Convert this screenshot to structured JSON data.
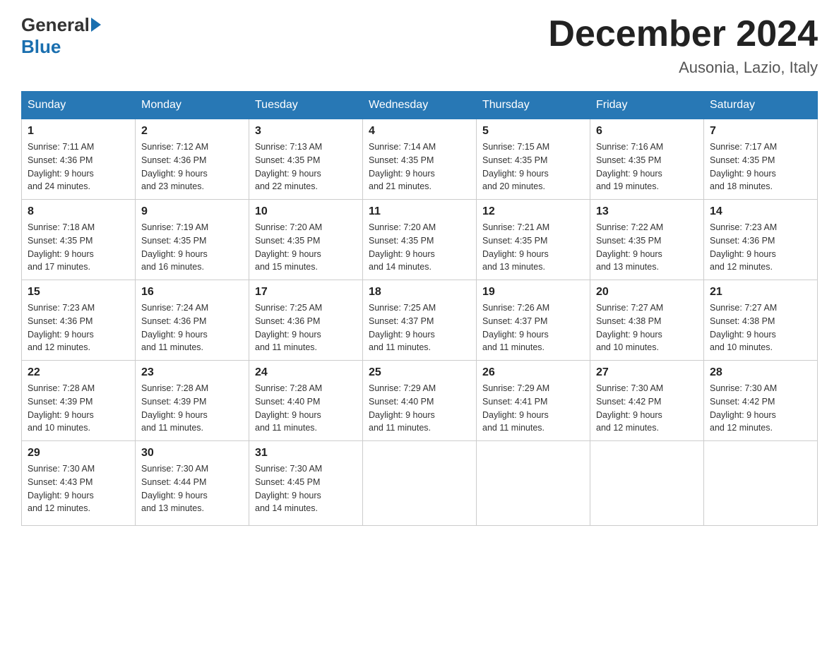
{
  "logo": {
    "general": "General",
    "blue": "Blue"
  },
  "title": "December 2024",
  "subtitle": "Ausonia, Lazio, Italy",
  "weekdays": [
    "Sunday",
    "Monday",
    "Tuesday",
    "Wednesday",
    "Thursday",
    "Friday",
    "Saturday"
  ],
  "weeks": [
    [
      {
        "day": "1",
        "sunrise": "7:11 AM",
        "sunset": "4:36 PM",
        "daylight": "9 hours and 24 minutes."
      },
      {
        "day": "2",
        "sunrise": "7:12 AM",
        "sunset": "4:36 PM",
        "daylight": "9 hours and 23 minutes."
      },
      {
        "day": "3",
        "sunrise": "7:13 AM",
        "sunset": "4:35 PM",
        "daylight": "9 hours and 22 minutes."
      },
      {
        "day": "4",
        "sunrise": "7:14 AM",
        "sunset": "4:35 PM",
        "daylight": "9 hours and 21 minutes."
      },
      {
        "day": "5",
        "sunrise": "7:15 AM",
        "sunset": "4:35 PM",
        "daylight": "9 hours and 20 minutes."
      },
      {
        "day": "6",
        "sunrise": "7:16 AM",
        "sunset": "4:35 PM",
        "daylight": "9 hours and 19 minutes."
      },
      {
        "day": "7",
        "sunrise": "7:17 AM",
        "sunset": "4:35 PM",
        "daylight": "9 hours and 18 minutes."
      }
    ],
    [
      {
        "day": "8",
        "sunrise": "7:18 AM",
        "sunset": "4:35 PM",
        "daylight": "9 hours and 17 minutes."
      },
      {
        "day": "9",
        "sunrise": "7:19 AM",
        "sunset": "4:35 PM",
        "daylight": "9 hours and 16 minutes."
      },
      {
        "day": "10",
        "sunrise": "7:20 AM",
        "sunset": "4:35 PM",
        "daylight": "9 hours and 15 minutes."
      },
      {
        "day": "11",
        "sunrise": "7:20 AM",
        "sunset": "4:35 PM",
        "daylight": "9 hours and 14 minutes."
      },
      {
        "day": "12",
        "sunrise": "7:21 AM",
        "sunset": "4:35 PM",
        "daylight": "9 hours and 13 minutes."
      },
      {
        "day": "13",
        "sunrise": "7:22 AM",
        "sunset": "4:35 PM",
        "daylight": "9 hours and 13 minutes."
      },
      {
        "day": "14",
        "sunrise": "7:23 AM",
        "sunset": "4:36 PM",
        "daylight": "9 hours and 12 minutes."
      }
    ],
    [
      {
        "day": "15",
        "sunrise": "7:23 AM",
        "sunset": "4:36 PM",
        "daylight": "9 hours and 12 minutes."
      },
      {
        "day": "16",
        "sunrise": "7:24 AM",
        "sunset": "4:36 PM",
        "daylight": "9 hours and 11 minutes."
      },
      {
        "day": "17",
        "sunrise": "7:25 AM",
        "sunset": "4:36 PM",
        "daylight": "9 hours and 11 minutes."
      },
      {
        "day": "18",
        "sunrise": "7:25 AM",
        "sunset": "4:37 PM",
        "daylight": "9 hours and 11 minutes."
      },
      {
        "day": "19",
        "sunrise": "7:26 AM",
        "sunset": "4:37 PM",
        "daylight": "9 hours and 11 minutes."
      },
      {
        "day": "20",
        "sunrise": "7:27 AM",
        "sunset": "4:38 PM",
        "daylight": "9 hours and 10 minutes."
      },
      {
        "day": "21",
        "sunrise": "7:27 AM",
        "sunset": "4:38 PM",
        "daylight": "9 hours and 10 minutes."
      }
    ],
    [
      {
        "day": "22",
        "sunrise": "7:28 AM",
        "sunset": "4:39 PM",
        "daylight": "9 hours and 10 minutes."
      },
      {
        "day": "23",
        "sunrise": "7:28 AM",
        "sunset": "4:39 PM",
        "daylight": "9 hours and 11 minutes."
      },
      {
        "day": "24",
        "sunrise": "7:28 AM",
        "sunset": "4:40 PM",
        "daylight": "9 hours and 11 minutes."
      },
      {
        "day": "25",
        "sunrise": "7:29 AM",
        "sunset": "4:40 PM",
        "daylight": "9 hours and 11 minutes."
      },
      {
        "day": "26",
        "sunrise": "7:29 AM",
        "sunset": "4:41 PM",
        "daylight": "9 hours and 11 minutes."
      },
      {
        "day": "27",
        "sunrise": "7:30 AM",
        "sunset": "4:42 PM",
        "daylight": "9 hours and 12 minutes."
      },
      {
        "day": "28",
        "sunrise": "7:30 AM",
        "sunset": "4:42 PM",
        "daylight": "9 hours and 12 minutes."
      }
    ],
    [
      {
        "day": "29",
        "sunrise": "7:30 AM",
        "sunset": "4:43 PM",
        "daylight": "9 hours and 12 minutes."
      },
      {
        "day": "30",
        "sunrise": "7:30 AM",
        "sunset": "4:44 PM",
        "daylight": "9 hours and 13 minutes."
      },
      {
        "day": "31",
        "sunrise": "7:30 AM",
        "sunset": "4:45 PM",
        "daylight": "9 hours and 14 minutes."
      },
      null,
      null,
      null,
      null
    ]
  ],
  "labels": {
    "sunrise": "Sunrise:",
    "sunset": "Sunset:",
    "daylight": "Daylight:"
  }
}
